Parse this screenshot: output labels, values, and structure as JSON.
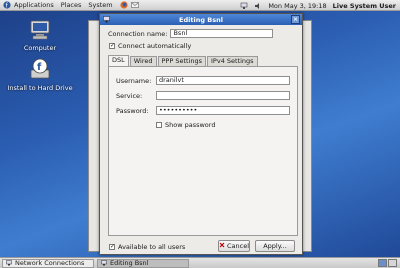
{
  "top_panel": {
    "menus": [
      "Applications",
      "Places",
      "System"
    ],
    "clock": "Mon May  3, 19:18",
    "user": "Live System User"
  },
  "desktop": {
    "icons": [
      {
        "label": "Computer",
        "icon": "computer-icon"
      },
      {
        "label": "Install to Hard Drive",
        "icon": "install-icon"
      }
    ]
  },
  "dialog": {
    "title": "Editing Bsnl",
    "connection_name_label": "Connection name:",
    "connection_name_value": "Bsnl",
    "connect_automatically_label": "Connect automatically",
    "connect_automatically_checked": true,
    "tabs": [
      "DSL",
      "Wired",
      "PPP Settings",
      "IPv4 Settings"
    ],
    "active_tab": "DSL",
    "dsl": {
      "username_label": "Username:",
      "username_value": "dranilvt",
      "service_label": "Service:",
      "service_value": "",
      "password_label": "Password:",
      "password_value": "••••••••••",
      "show_password_label": "Show password",
      "show_password_checked": false
    },
    "available_to_all_label": "Available to all users",
    "available_to_all_checked": true,
    "cancel_label": "Cancel",
    "apply_label": "Apply..."
  },
  "taskbar": {
    "items": [
      "Network Connections",
      "Editing Bsnl"
    ],
    "active_index": 1
  },
  "colors": {
    "titlebar": "#2b5fb3",
    "desktop": "#2a5cb0"
  }
}
